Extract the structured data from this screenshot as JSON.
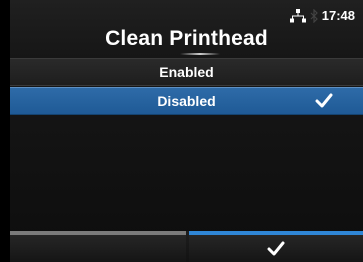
{
  "status_bar": {
    "time": "17:48",
    "icons": [
      "network-icon",
      "bluetooth-icon"
    ]
  },
  "header": {
    "title": "Clean Printhead"
  },
  "options": [
    {
      "label": "Enabled",
      "selected": false
    },
    {
      "label": "Disabled",
      "selected": true,
      "checked": true
    }
  ],
  "footer": {
    "left_button": {
      "label": "",
      "icon": "none"
    },
    "right_button": {
      "label": "",
      "icon": "check-icon"
    }
  },
  "colors": {
    "accent_blue": "#2f86d6",
    "selected_row": "#2a67a3",
    "background": "#000000",
    "text": "#ffffff"
  }
}
